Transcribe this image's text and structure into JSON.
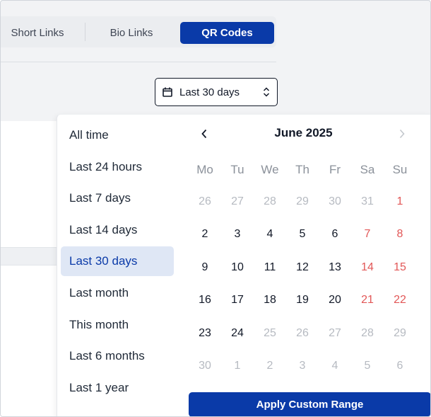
{
  "tabs": [
    {
      "label": "Short Links",
      "active": false
    },
    {
      "label": "Bio Links",
      "active": false
    },
    {
      "label": "QR Codes",
      "active": true
    }
  ],
  "range_picker": {
    "current_label": "Last 30 days",
    "icon": "calendar-icon",
    "toggle_icon": "chevron-up-down-icon"
  },
  "presets": [
    {
      "label": "All time"
    },
    {
      "label": "Last 24 hours"
    },
    {
      "label": "Last 7 days"
    },
    {
      "label": "Last 14 days"
    },
    {
      "label": "Last 30 days",
      "selected": true
    },
    {
      "label": "Last month"
    },
    {
      "label": "This month"
    },
    {
      "label": "Last 6 months"
    },
    {
      "label": "Last 1 year"
    }
  ],
  "calendar": {
    "month_label": "June 2025",
    "weekdays": [
      "Mo",
      "Tu",
      "We",
      "Th",
      "Fr",
      "Sa",
      "Su"
    ],
    "weeks": [
      [
        {
          "d": "26",
          "s": "muted"
        },
        {
          "d": "27",
          "s": "muted"
        },
        {
          "d": "28",
          "s": "muted"
        },
        {
          "d": "29",
          "s": "muted"
        },
        {
          "d": "30",
          "s": "muted"
        },
        {
          "d": "31",
          "s": "muted"
        },
        {
          "d": "1",
          "s": "weekend"
        }
      ],
      [
        {
          "d": "2",
          "s": "normal"
        },
        {
          "d": "3",
          "s": "normal"
        },
        {
          "d": "4",
          "s": "normal"
        },
        {
          "d": "5",
          "s": "normal"
        },
        {
          "d": "6",
          "s": "normal"
        },
        {
          "d": "7",
          "s": "weekend"
        },
        {
          "d": "8",
          "s": "weekend"
        }
      ],
      [
        {
          "d": "9",
          "s": "normal"
        },
        {
          "d": "10",
          "s": "normal"
        },
        {
          "d": "11",
          "s": "normal"
        },
        {
          "d": "12",
          "s": "normal"
        },
        {
          "d": "13",
          "s": "normal"
        },
        {
          "d": "14",
          "s": "weekend"
        },
        {
          "d": "15",
          "s": "weekend"
        }
      ],
      [
        {
          "d": "16",
          "s": "normal"
        },
        {
          "d": "17",
          "s": "normal"
        },
        {
          "d": "18",
          "s": "normal"
        },
        {
          "d": "19",
          "s": "normal"
        },
        {
          "d": "20",
          "s": "normal"
        },
        {
          "d": "21",
          "s": "weekend"
        },
        {
          "d": "22",
          "s": "weekend"
        }
      ],
      [
        {
          "d": "23",
          "s": "normal"
        },
        {
          "d": "24",
          "s": "normal"
        },
        {
          "d": "25",
          "s": "muted"
        },
        {
          "d": "26",
          "s": "muted"
        },
        {
          "d": "27",
          "s": "muted"
        },
        {
          "d": "28",
          "s": "muted"
        },
        {
          "d": "29",
          "s": "muted"
        }
      ],
      [
        {
          "d": "30",
          "s": "muted"
        },
        {
          "d": "1",
          "s": "muted"
        },
        {
          "d": "2",
          "s": "muted"
        },
        {
          "d": "3",
          "s": "muted"
        },
        {
          "d": "4",
          "s": "muted"
        },
        {
          "d": "5",
          "s": "muted"
        },
        {
          "d": "6",
          "s": "muted"
        }
      ]
    ],
    "prev_icon": "chevron-left-icon",
    "next_icon": "chevron-right-icon"
  },
  "apply_button": {
    "label": "Apply Custom Range"
  },
  "colors": {
    "primary": "#0a3aa8",
    "selected_bg": "#dfe7f5",
    "weekend": "#e25757",
    "muted": "#b6bac1"
  }
}
